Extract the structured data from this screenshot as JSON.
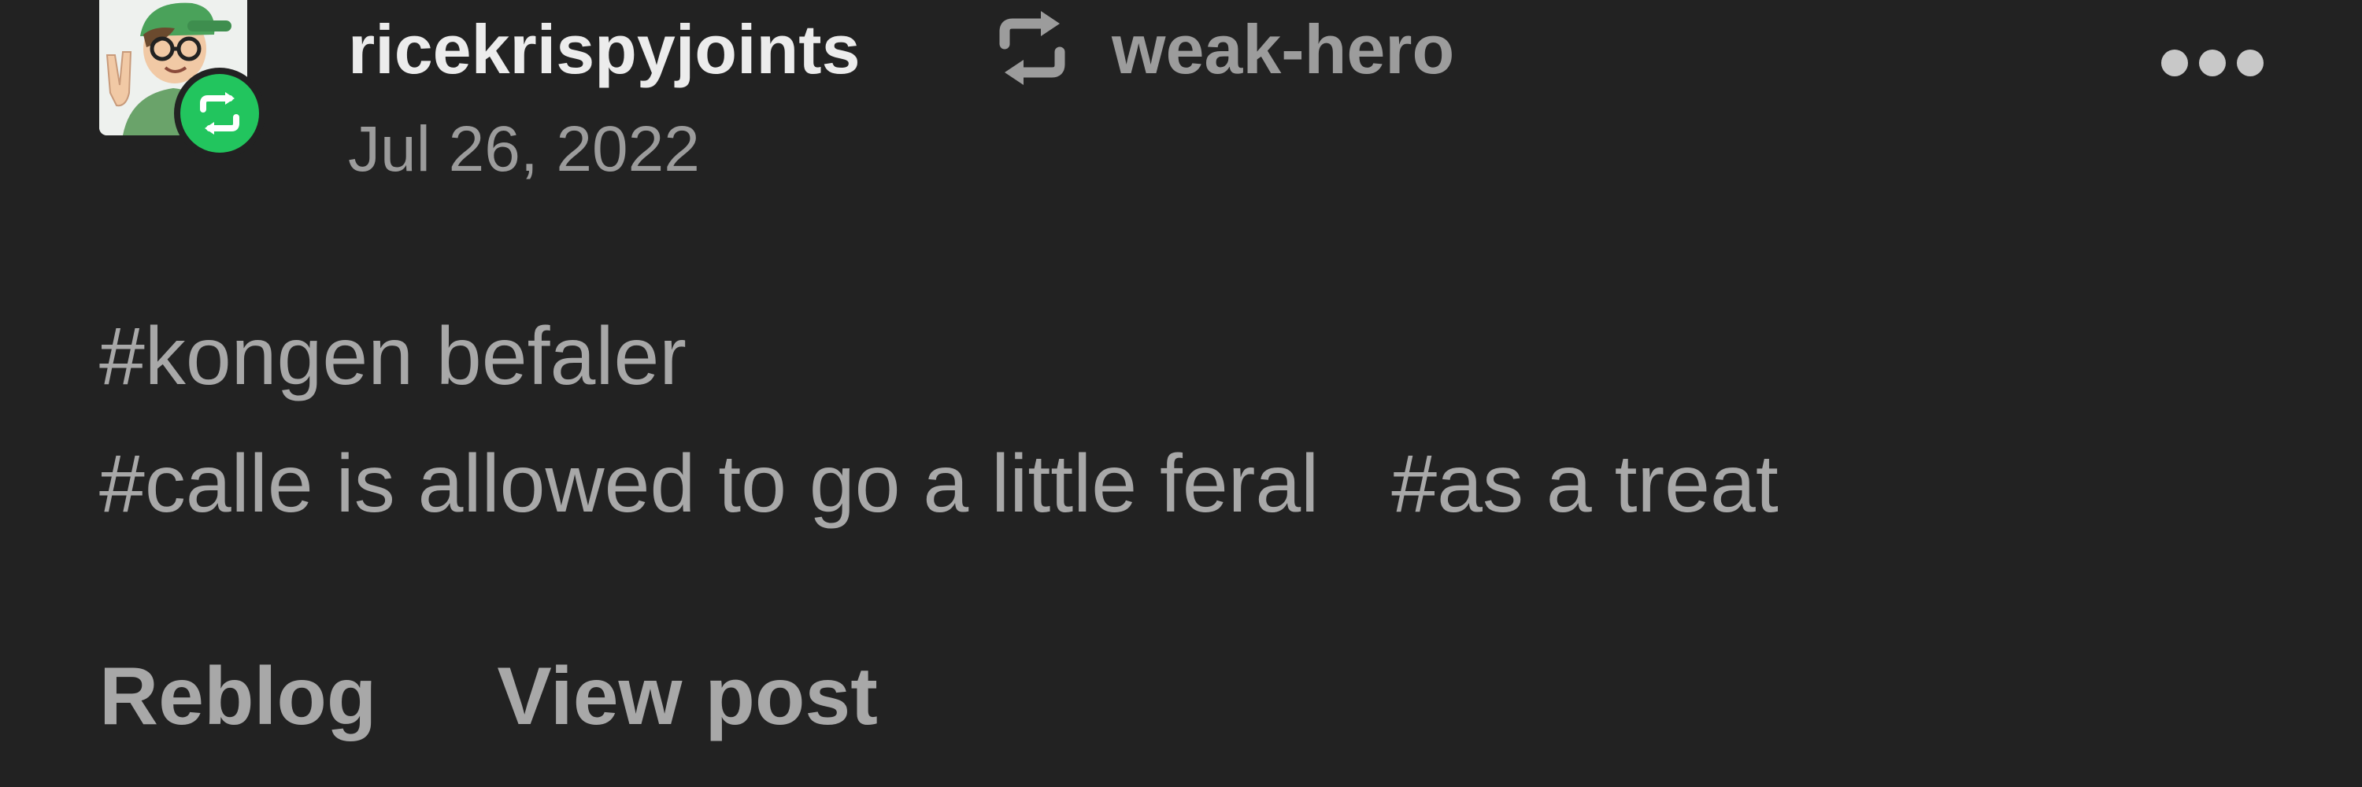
{
  "post": {
    "username": "ricekrispyjoints",
    "reblogged_from": "weak-hero",
    "date": "Jul 26, 2022",
    "avatar": "avatar-illustration-person-with-green-cap-and-glasses",
    "badge_icon": "reblog-icon",
    "menu_icon": "more-horizontal-icon",
    "tags": [
      [
        "#kongen befaler"
      ],
      [
        "#calle is allowed to go a little feral",
        "#as a treat"
      ]
    ]
  },
  "actions": {
    "reblog_label": "Reblog",
    "view_post_label": "View post"
  },
  "colors": {
    "background": "#222222",
    "primary_text": "#ececec",
    "secondary_text": "#9c9c9c",
    "reblog_badge": "#22c55e"
  }
}
